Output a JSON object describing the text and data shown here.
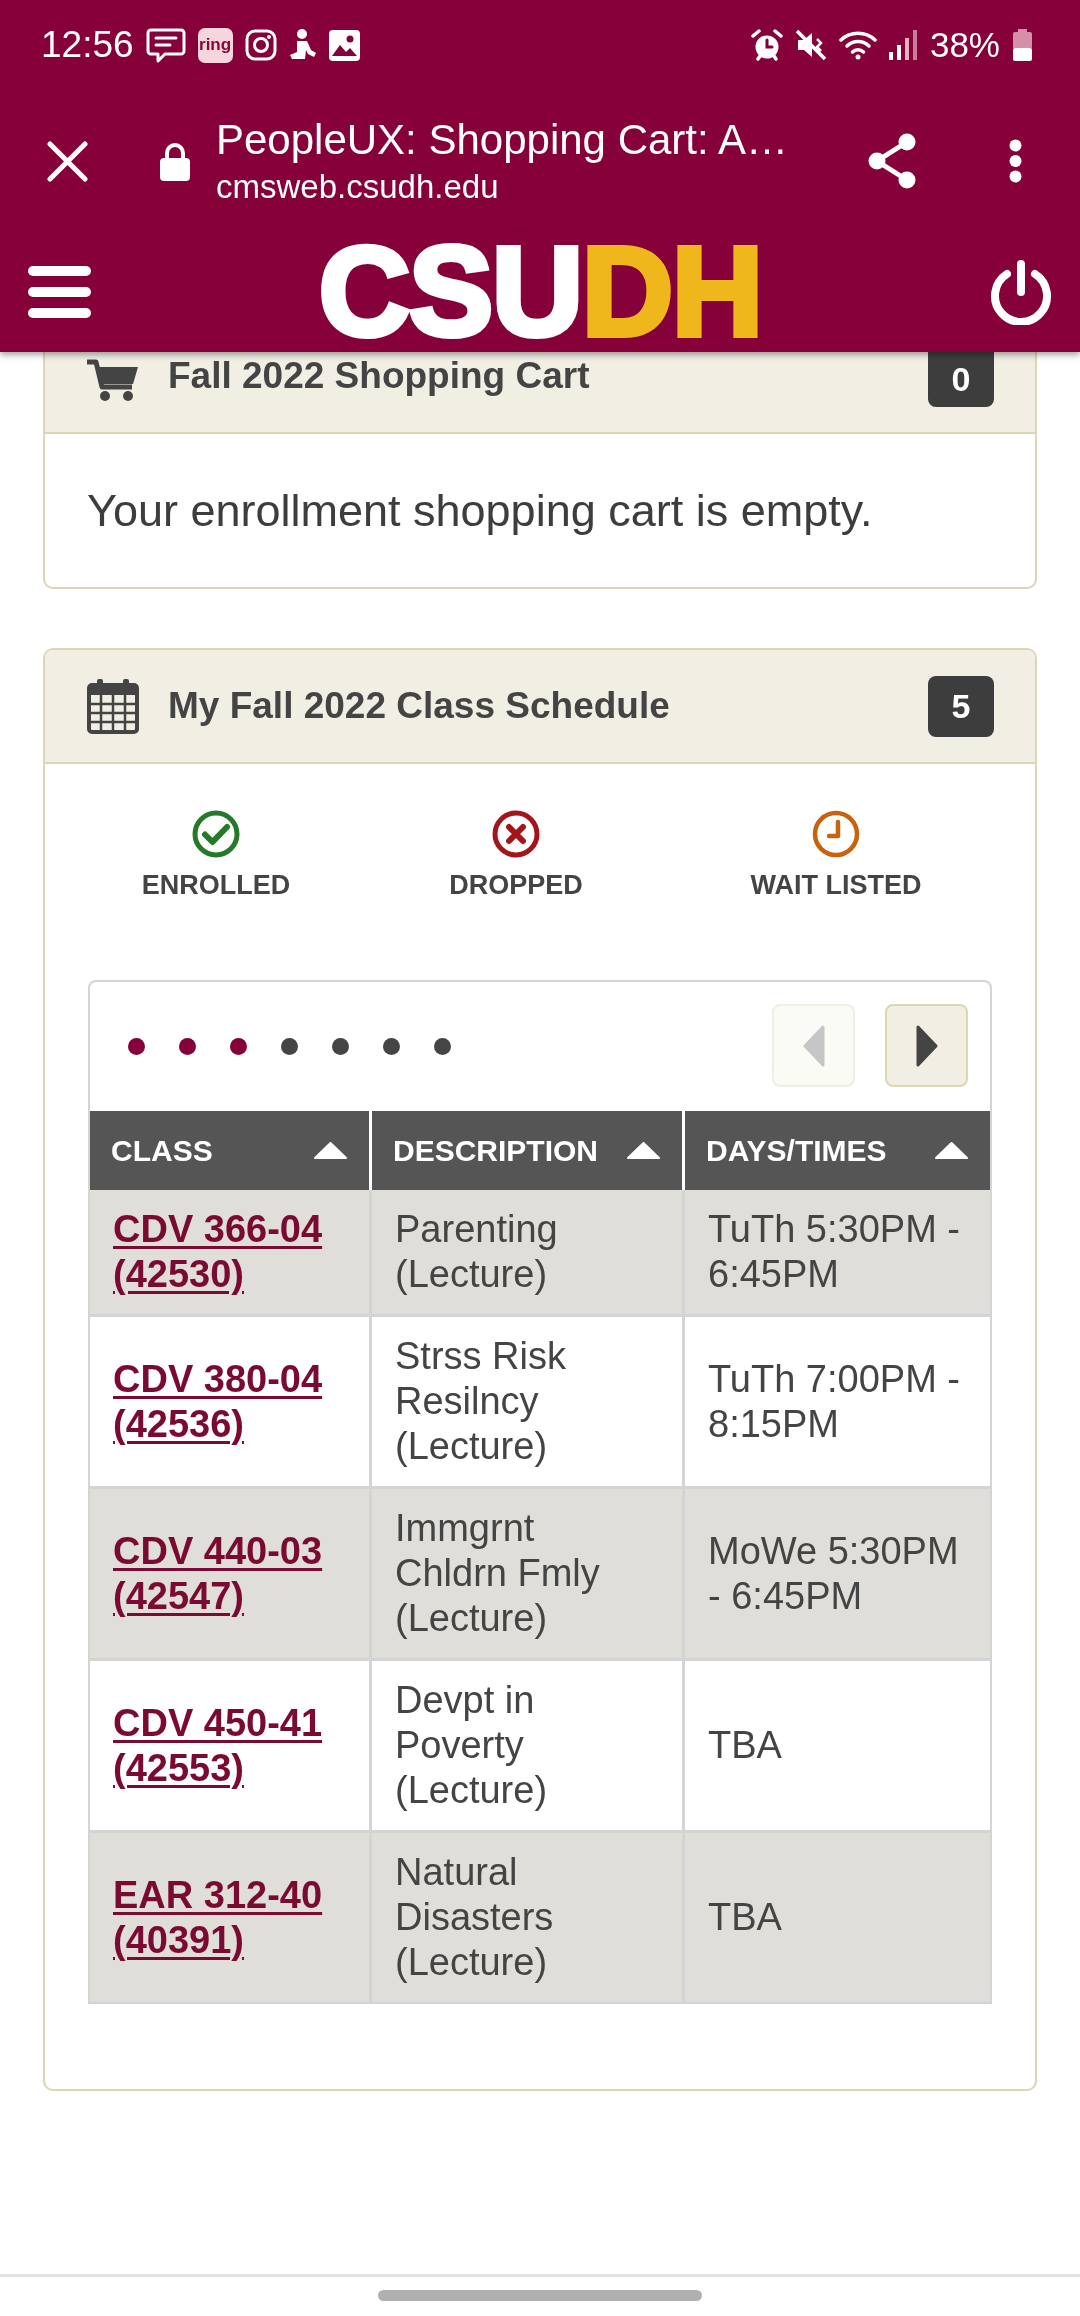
{
  "status_bar": {
    "time": "12:56",
    "app_badge": "ring",
    "battery": "38%"
  },
  "browser_bar": {
    "title": "PeopleUX: Shopping Cart: A…",
    "url": "cmsweb.csudh.edu"
  },
  "site_header": {
    "logo": [
      {
        "text": "CSU",
        "color": "#ffffff"
      },
      {
        "text": "DH",
        "color": "#f0b71c"
      }
    ]
  },
  "shopping_cart": {
    "title": "Fall 2022 Shopping Cart",
    "count": "0",
    "message": "Your enrollment shopping cart is empty."
  },
  "class_schedule": {
    "title": "My Fall 2022 Class Schedule",
    "count": "5",
    "legend": [
      {
        "kind": "enrolled",
        "label": "ENROLLED"
      },
      {
        "kind": "dropped",
        "label": "DROPPED"
      },
      {
        "kind": "waitlisted",
        "label": "WAIT LISTED"
      }
    ],
    "pager": {
      "dots": [
        {
          "selected": true
        },
        {
          "selected": true
        },
        {
          "selected": true
        },
        {
          "selected": false
        },
        {
          "selected": false
        },
        {
          "selected": false
        },
        {
          "selected": false
        }
      ],
      "previous": {
        "disabled": true
      },
      "next": {
        "disabled": false
      }
    },
    "table": {
      "columns": [
        {
          "label": "CLASS",
          "sorted": true
        },
        {
          "label": "DESCRIPTION",
          "sorted": true
        },
        {
          "label": "DAYS/TIMES",
          "sorted": true
        }
      ],
      "rows": [
        {
          "class": "CDV 366-04 (42530)",
          "description": "Parenting (Lecture)",
          "days_times": "TuTh 5:30PM - 6:45PM"
        },
        {
          "class": "CDV 380-04 (42536)",
          "description": "Strss Risk Resilncy (Lecture)",
          "days_times": "TuTh 7:00PM - 8:15PM"
        },
        {
          "class": "CDV 440-03 (42547)",
          "description": "Immgrnt Chldrn Fmly (Lecture)",
          "days_times": "MoWe 5:30PM - 6:45PM"
        },
        {
          "class": "CDV 450-41 (42553)",
          "description": "Devpt in Poverty (Lecture)",
          "days_times": "TBA"
        },
        {
          "class": "EAR 312-40 (40391)",
          "description": "Natural Disasters (Lecture)",
          "days_times": "TBA"
        }
      ]
    }
  }
}
